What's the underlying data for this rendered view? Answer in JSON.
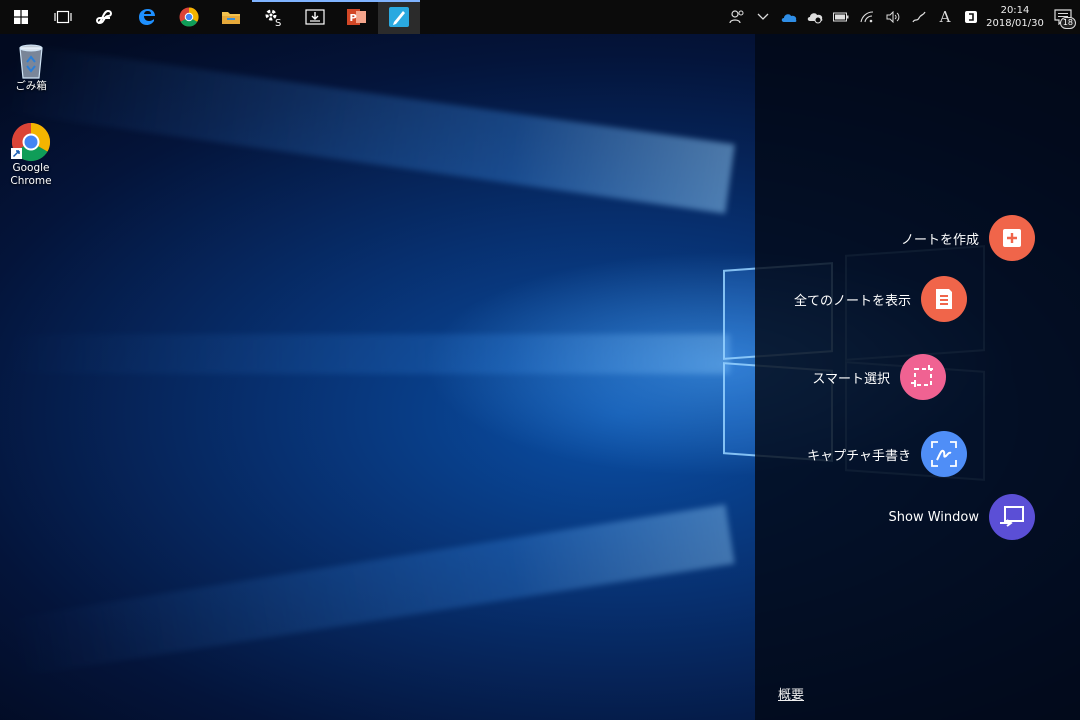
{
  "taskbar": {
    "apps": [
      {
        "icon": "start-windows-icon"
      },
      {
        "icon": "task-view-icon"
      },
      {
        "icon": "f-app-icon"
      },
      {
        "icon": "edge-icon"
      },
      {
        "icon": "chrome-icon"
      },
      {
        "icon": "file-explorer-icon"
      },
      {
        "icon": "settings-app-icon"
      },
      {
        "icon": "download-box-icon"
      },
      {
        "icon": "powerpoint-icon"
      },
      {
        "icon": "pen-note-app-icon"
      }
    ],
    "tray": {
      "clock_time": "20:14",
      "clock_date": "2018/01/30",
      "ime_label": "A",
      "notification_count": "18"
    }
  },
  "desktop": {
    "recycle_bin_label": "ごみ箱",
    "chrome_label_line1": "Google",
    "chrome_label_line2": "Chrome"
  },
  "panel": {
    "actions": [
      {
        "label": "ノートを作成",
        "color": "#f0654a",
        "icon": "create-note-icon"
      },
      {
        "label": "全てのノートを表示",
        "color": "#f0654a",
        "icon": "all-notes-icon"
      },
      {
        "label": "スマート選択",
        "color": "#f06292",
        "icon": "smart-select-icon"
      },
      {
        "label": "キャプチャ手書き",
        "color": "#4f8ef7",
        "icon": "capture-handwriting-icon"
      },
      {
        "label": "Show Window",
        "color": "#5b4fd6",
        "icon": "show-window-icon"
      }
    ],
    "about_link": "概要"
  }
}
